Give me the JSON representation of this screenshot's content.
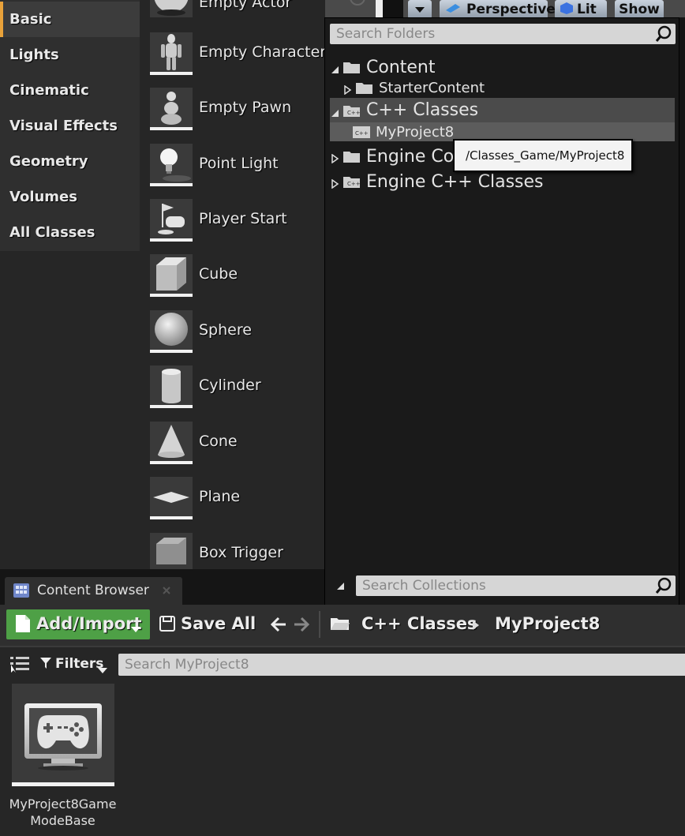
{
  "categories": [
    {
      "label": "Basic",
      "active": true
    },
    {
      "label": "Lights",
      "active": false
    },
    {
      "label": "Cinematic",
      "active": false
    },
    {
      "label": "Visual Effects",
      "active": false
    },
    {
      "label": "Geometry",
      "active": false
    },
    {
      "label": "Volumes",
      "active": false
    },
    {
      "label": "All Classes",
      "active": false
    }
  ],
  "actors": [
    {
      "label": "Empty Actor",
      "icon": "sphere-partial-icon"
    },
    {
      "label": "Empty Character",
      "icon": "mannequin-icon"
    },
    {
      "label": "Empty Pawn",
      "icon": "pawn-icon"
    },
    {
      "label": "Point Light",
      "icon": "lightbulb-icon"
    },
    {
      "label": "Player Start",
      "icon": "player-start-icon"
    },
    {
      "label": "Cube",
      "icon": "cube-icon"
    },
    {
      "label": "Sphere",
      "icon": "sphere-icon"
    },
    {
      "label": "Cylinder",
      "icon": "cylinder-icon"
    },
    {
      "label": "Cone",
      "icon": "cone-icon"
    },
    {
      "label": "Plane",
      "icon": "plane-icon"
    },
    {
      "label": "Box Trigger",
      "icon": "box-trigger-icon"
    }
  ],
  "viewport": {
    "perspective_label": "Perspective",
    "lit_label": "Lit",
    "show_label": "Show"
  },
  "folder_popup": {
    "search_placeholder": "Search Folders",
    "collections_placeholder": "Search Collections",
    "tree": {
      "content": "Content",
      "starter_content": "StarterContent",
      "cpp_classes": "C++ Classes",
      "my_project": "MyProject8",
      "engine_content": "Engine Co",
      "engine_cpp": "Engine C++ Classes"
    },
    "tooltip": "/Classes_Game/MyProject8"
  },
  "content_browser": {
    "tab_label": "Content Browser",
    "add_import_label": "Add/Import",
    "save_all_label": "Save All",
    "breadcrumb": [
      "C++ Classes",
      "MyProject8"
    ],
    "filters_label": "Filters",
    "search_placeholder": "Search MyProject8",
    "assets": [
      {
        "name_line1": "MyProject8Game",
        "name_line2": "ModeBase",
        "icon": "gamepad-icon"
      }
    ]
  },
  "colors": {
    "accent_orange": "#e9a23a",
    "add_import_green": "#4ea046",
    "panel_bg": "#2f2f2f"
  }
}
